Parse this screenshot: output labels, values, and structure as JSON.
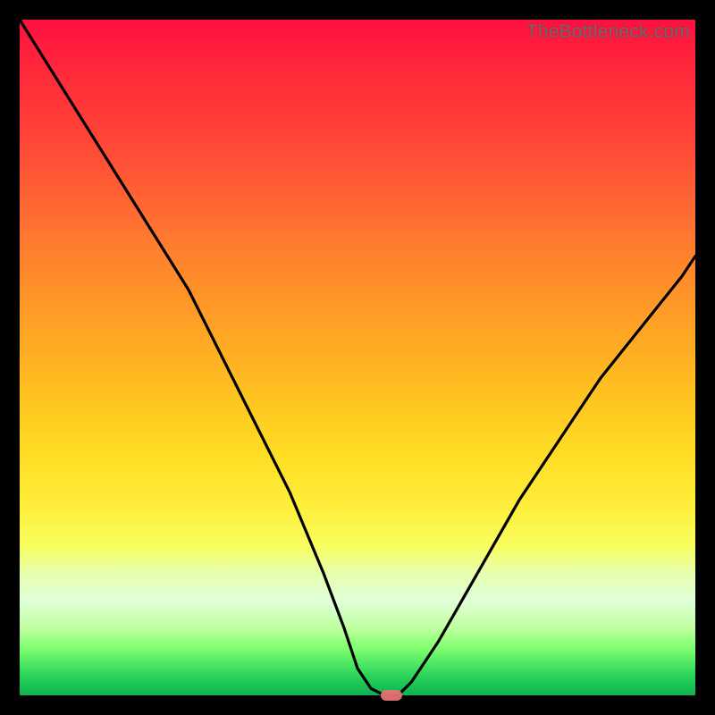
{
  "watermark": "TheBottleneck.com",
  "chart_data": {
    "type": "line",
    "title": "",
    "xlabel": "",
    "ylabel": "",
    "xlim": [
      0,
      100
    ],
    "ylim": [
      0,
      100
    ],
    "grid": false,
    "series": [
      {
        "name": "bottleneck-curve",
        "x": [
          0,
          5,
          10,
          15,
          20,
          25,
          30,
          35,
          40,
          45,
          48,
          50,
          52,
          54,
          56,
          58,
          62,
          66,
          70,
          74,
          78,
          82,
          86,
          90,
          94,
          98,
          100
        ],
        "y": [
          100,
          92,
          84,
          76,
          68,
          60,
          50,
          40,
          30,
          18,
          10,
          4,
          1,
          0,
          0,
          2,
          8,
          15,
          22,
          29,
          35,
          41,
          47,
          52,
          57,
          62,
          65
        ]
      }
    ],
    "marker": {
      "x": 55,
      "y": 0,
      "color": "#e57373",
      "shape": "pill"
    }
  }
}
